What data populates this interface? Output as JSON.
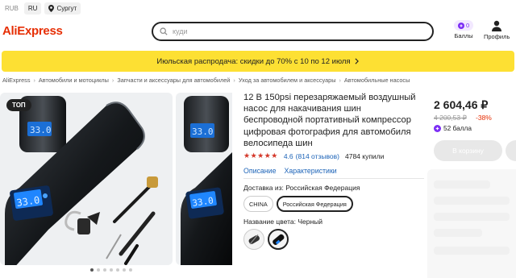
{
  "topbar": {
    "currency": "RUB",
    "language": "RU",
    "city": "Сургут"
  },
  "header": {
    "logo": "AliExpress",
    "search_placeholder": "куди",
    "points_value": "0",
    "points_label": "Баллы",
    "profile_label": "Профиль"
  },
  "promo": {
    "text": "Июльская распродача: скидки до 70% с 10 по 12 июля"
  },
  "breadcrumbs": [
    "AliExpress",
    "Автомобили и мотоциклы",
    "Запчасти и аксессуары для автомобилей",
    "Уход за автомобилем и аксессуары",
    "Автомобильные насосы"
  ],
  "gallery": {
    "badge": "ТОП",
    "lcd_value": "33.0",
    "dots_total": 7,
    "dots_active": 0
  },
  "product": {
    "title": "12 В 150psi перезаряжаемый воздушный насос для накачивания шин беспроводной портативный компрессор цифровая фотография для автомобиля велосипеда шин",
    "rating_value": "4.6",
    "rating_stars": 4.6,
    "reviews": "(814 отзывов)",
    "sold": "4784 купили",
    "tab_description": "Описание",
    "tab_specs": "Характеристики",
    "shipping_label": "Доставка из: Российская Федерация",
    "shipping_options": [
      "CHINA",
      "Российская Федерация"
    ],
    "shipping_selected": 1,
    "color_label": "Название цвета: Черный"
  },
  "buybox": {
    "price": "2 604,46 ₽",
    "old_price": "4 200,53 ₽",
    "discount": "-38%",
    "points": "52 балла",
    "cart_button": "В корзину"
  },
  "colors": {
    "accent": "#e62e04",
    "promo_bg": "#fde033",
    "link": "#1d64b8",
    "star": "#d4382a",
    "points_purple": "#7b2cf5"
  }
}
